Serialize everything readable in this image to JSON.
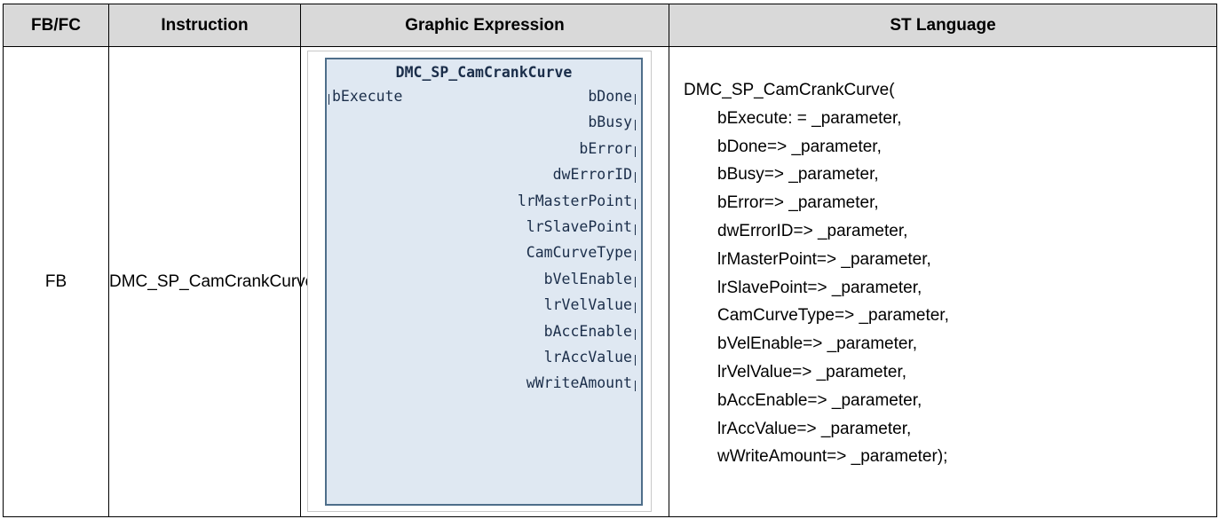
{
  "table": {
    "headers": [
      "FB/FC",
      "Instruction",
      "Graphic Expression",
      "ST Language"
    ],
    "row": {
      "type": "FB",
      "instruction": "DMC_SP_CamCrankCurve"
    }
  },
  "graphic": {
    "title": "DMC_SP_CamCrankCurve",
    "inputs": [
      "bExecute"
    ],
    "outputs": [
      "bDone",
      "bBusy",
      "bError",
      "dwErrorID",
      "lrMasterPoint",
      "lrSlavePoint",
      "CamCurveType",
      "bVelEnable",
      "lrVelValue",
      "bAccEnable",
      "lrAccValue",
      "wWriteAmount"
    ]
  },
  "st": {
    "lines": [
      "DMC_SP_CamCrankCurve(",
      "bExecute: = _parameter,",
      "bDone=> _parameter,",
      "bBusy=> _parameter,",
      "bError=> _parameter,",
      "dwErrorID=> _parameter,",
      "lrMasterPoint=> _parameter,",
      "lrSlavePoint=> _parameter,",
      "CamCurveType=> _parameter,",
      "bVelEnable=> _parameter,",
      "lrVelValue=> _parameter,",
      "bAccEnable=> _parameter,",
      "lrAccValue=> _parameter,",
      "wWriteAmount=> _parameter);"
    ]
  },
  "colors": {
    "header_bg": "#d9d9d9",
    "fb_fill": "#dfe8f2",
    "fb_border": "#4e6e8a",
    "fb_text": "#1b2e4a"
  }
}
